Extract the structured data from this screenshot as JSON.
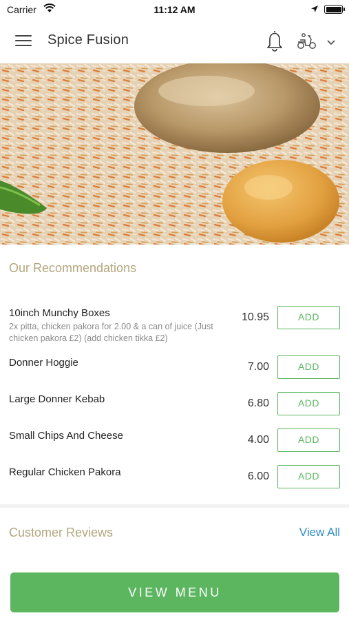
{
  "status_bar": {
    "carrier": "Carrier",
    "time": "11:12 AM"
  },
  "header": {
    "title": "Spice Fusion",
    "icons": [
      "menu-icon",
      "bell-icon",
      "delivery-scooter-icon",
      "chevron-down-icon"
    ]
  },
  "hero": {
    "image": "food-photo-biryani"
  },
  "recommendations": {
    "title": "Our Recommendations",
    "items": [
      {
        "name": "10inch Munchy Boxes",
        "desc": "2x pitta, chicken pakora for 2.00 & a can of juice (Just chicken pakora £2) (add chicken tikka £2)",
        "price": "10.95",
        "button": "ADD"
      },
      {
        "name": "Donner Hoggie",
        "desc": "",
        "price": "7.00",
        "button": "ADD"
      },
      {
        "name": "Large Donner Kebab",
        "desc": "",
        "price": "6.80",
        "button": "ADD"
      },
      {
        "name": "Small Chips And Cheese",
        "desc": "",
        "price": "4.00",
        "button": "ADD"
      },
      {
        "name": "Regular Chicken Pakora",
        "desc": "",
        "price": "6.00",
        "button": "ADD"
      }
    ]
  },
  "reviews": {
    "title": "Customer Reviews",
    "view_all": "View All"
  },
  "footer": {
    "view_menu": "VIEW MENU"
  },
  "colors": {
    "accent_green": "#5cb660",
    "section_title": "#b3a67e",
    "link_blue": "#2a8cc4"
  }
}
